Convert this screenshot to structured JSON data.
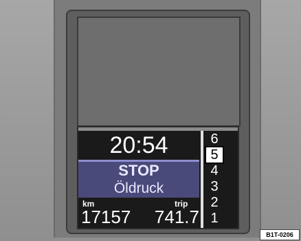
{
  "display": {
    "clock": "20:54",
    "message": {
      "title": "STOP",
      "subtitle": "Öldruck"
    },
    "odometer": {
      "km_label": "km",
      "trip_label": "trip",
      "km_value": "17157",
      "trip_value": "741.7"
    },
    "gears": [
      "6",
      "5",
      "4",
      "3",
      "2",
      "1"
    ],
    "active_gear": "5"
  },
  "figure_tag": "B1T-0206",
  "colors": {
    "screen_bg": "#1a1a1a",
    "message_bg": "#4a4a7a",
    "text": "#ffffff"
  }
}
